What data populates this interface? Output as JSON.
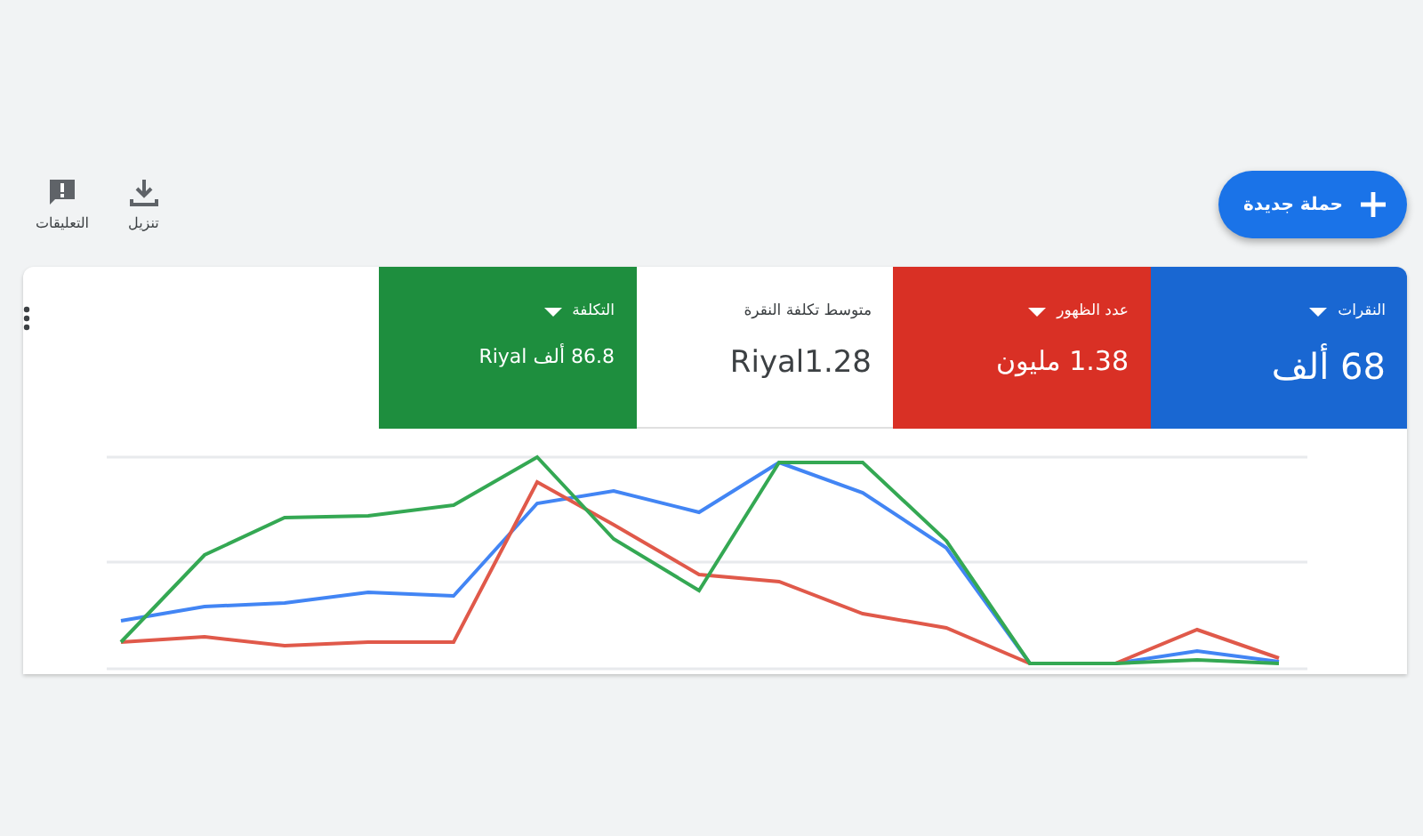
{
  "toolbar": {
    "new_campaign": {
      "label": "حملة جديدة"
    },
    "actions": [
      {
        "kind": "download",
        "label": "تنزيل"
      },
      {
        "kind": "feedback",
        "label": "التعليقات"
      }
    ]
  },
  "metrics": [
    {
      "label": "النقرات",
      "value": "68 ألف",
      "selected": true,
      "color": "#1967d2",
      "dropdown": true
    },
    {
      "label": "عدد الظهور",
      "value": "1.38 مليون",
      "selected": true,
      "color": "#d93025",
      "dropdown": true
    },
    {
      "label": "متوسط تكلفة النقرة",
      "value": "Riyal1.28",
      "selected": false,
      "dropdown": false
    },
    {
      "label": "التكلفة",
      "value": "86.8 ألف Riyal",
      "selected": true,
      "color": "#1e8e3e",
      "dropdown": true
    }
  ]
}
